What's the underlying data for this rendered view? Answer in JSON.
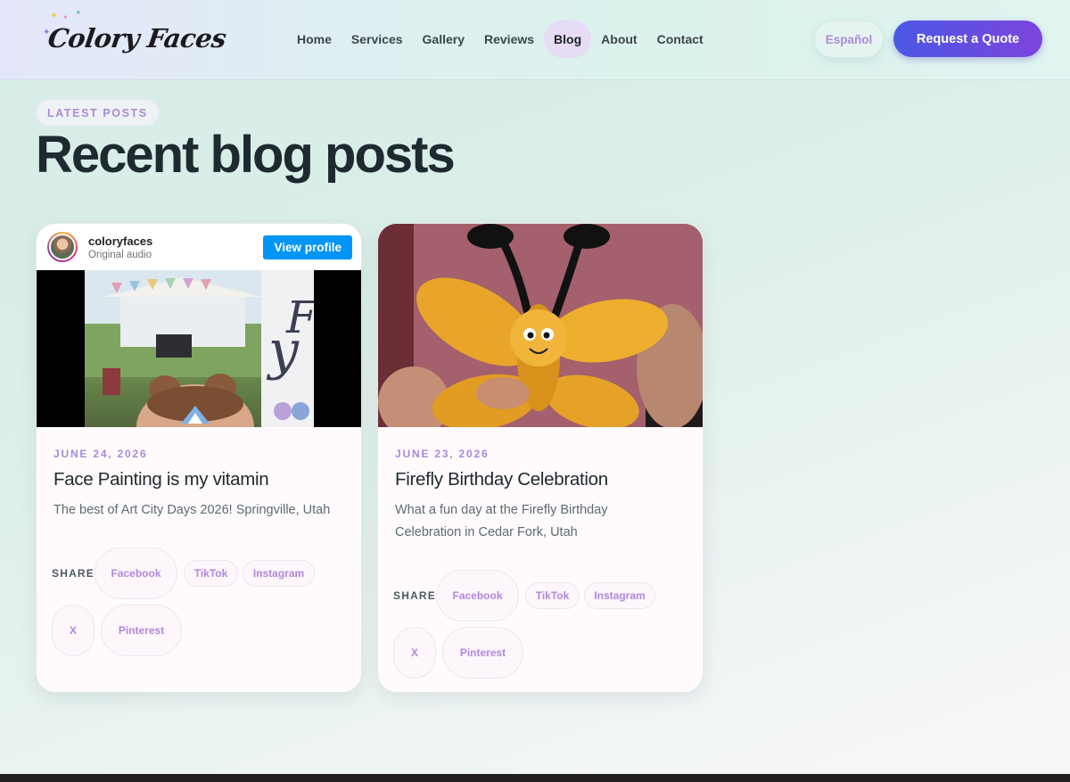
{
  "brand": {
    "logo_text": "Colory Faces"
  },
  "nav": {
    "items": [
      {
        "label": "Home"
      },
      {
        "label": "Services"
      },
      {
        "label": "Gallery"
      },
      {
        "label": "Reviews"
      },
      {
        "label": "Blog",
        "active": true
      },
      {
        "label": "About"
      },
      {
        "label": "Contact"
      }
    ],
    "language_label": "Español",
    "cta_label": "Request a Quote"
  },
  "hero": {
    "eyebrow": "LATEST POSTS",
    "title": "Recent blog posts"
  },
  "posts": [
    {
      "embed": {
        "username": "coloryfaces",
        "subtitle": "Original audio",
        "button_label": "View profile"
      },
      "date": "JUNE 24, 2026",
      "title": "Face Painting is my vitamin",
      "excerpt": "The best of Art City Days 2026! Springville, Utah",
      "share_label": "SHARE",
      "share": [
        "Facebook",
        "TikTok",
        "Instagram",
        "X",
        "Pinterest"
      ]
    },
    {
      "date": "JUNE 23, 2026",
      "title": "Firefly Birthday Celebration",
      "excerpt": "What a fun day at the Firefly Birthday Celebration in Cedar Fork, Utah",
      "share_label": "SHARE",
      "share": [
        "Facebook",
        "TikTok",
        "Instagram",
        "X",
        "Pinterest"
      ]
    }
  ],
  "colors": {
    "accent_purple": "#a988de",
    "cta_gradient_start": "#4b58e6",
    "cta_gradient_end": "#7c44dc",
    "instagram_blue": "#0095f6"
  }
}
